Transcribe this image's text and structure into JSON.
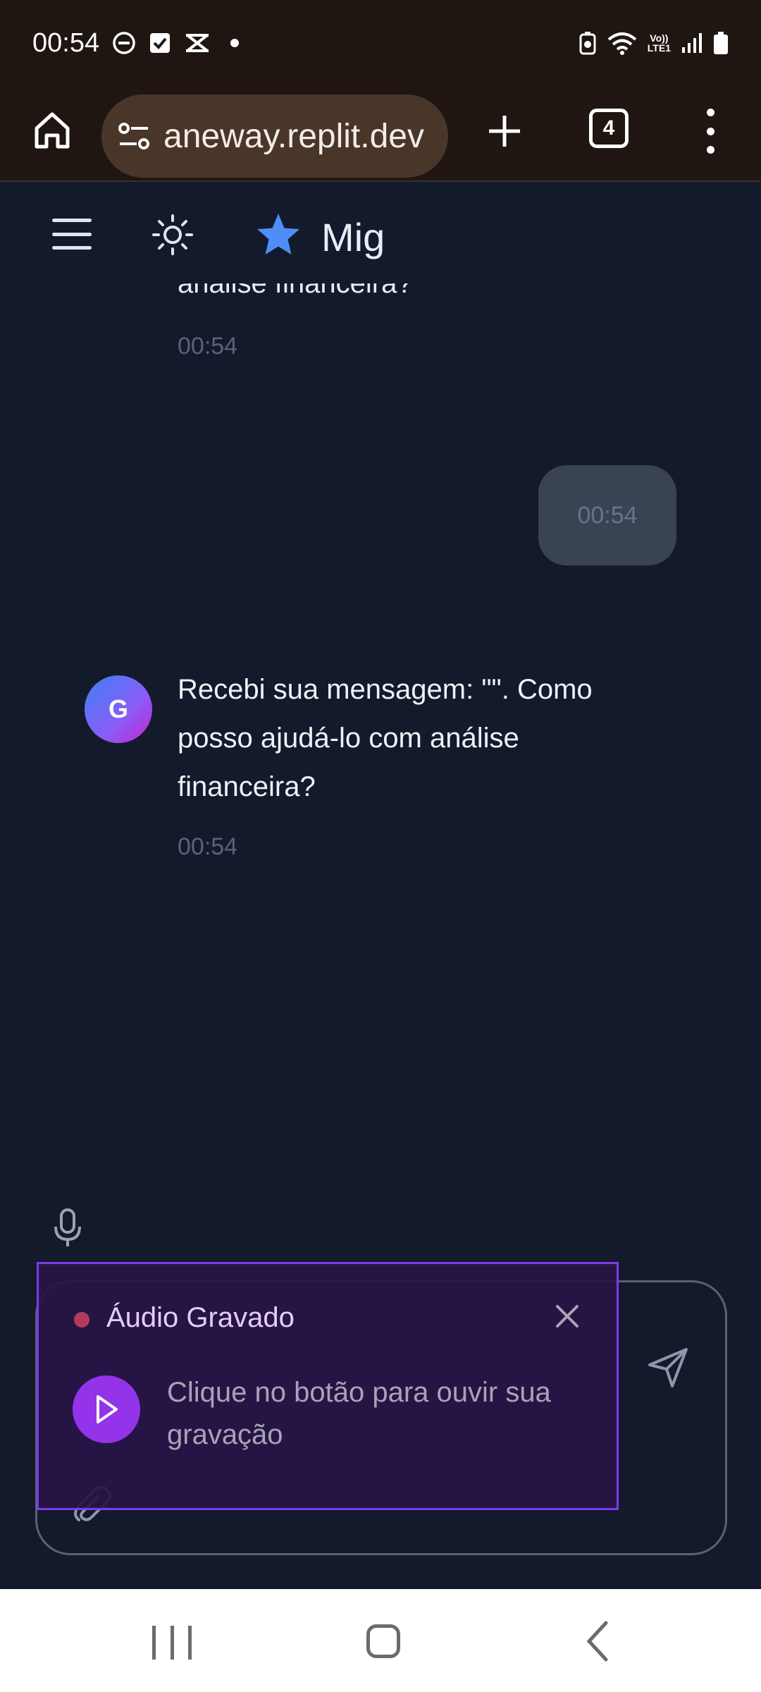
{
  "status_bar": {
    "time": "00:54",
    "network_label": "Vo))\nLTE1"
  },
  "browser": {
    "url": "aneway.replit.dev",
    "tab_count": "4"
  },
  "app": {
    "title": "Mig"
  },
  "chat": {
    "messages": [
      {
        "role": "assistant",
        "text": "análise financeira?",
        "time": "00:54",
        "partial": true
      },
      {
        "role": "user",
        "text": "",
        "time": "00:54"
      },
      {
        "role": "assistant",
        "avatar": "G",
        "text": "Recebi sua mensagem: \"\". Como posso ajudá-lo com análise financeira?",
        "time": "00:54"
      }
    ]
  },
  "audio_recording": {
    "title": "Áudio Gravado",
    "hint": "Clique no botão para ouvir sua gravação"
  },
  "colors": {
    "background": "#131a2b",
    "browser_bar": "#1f1612",
    "accent_purple": "#9333ea",
    "star_blue": "#4f8ef7",
    "recording_dot": "#b43b5c"
  },
  "icons": [
    "home-icon",
    "site-settings-icon",
    "plus-icon",
    "tabs-icon",
    "more-vert-icon",
    "menu-icon",
    "sun-icon",
    "star-icon",
    "mic-icon",
    "send-icon",
    "paperclip-icon",
    "close-icon",
    "play-icon"
  ]
}
